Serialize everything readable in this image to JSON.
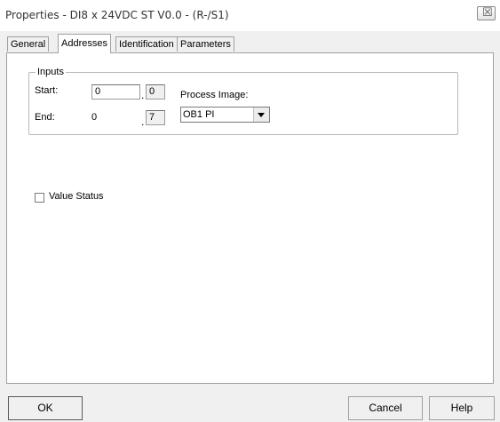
{
  "window": {
    "title": "Properties - DI8 x 24VDC ST V0.0 - (R-/S1)",
    "close_glyph": "☒"
  },
  "tabs": [
    {
      "label": "General",
      "active": false
    },
    {
      "label": "Addresses",
      "active": true
    },
    {
      "label": "Identification",
      "active": false
    },
    {
      "label": "Parameters",
      "active": false
    }
  ],
  "inputs": {
    "group_title": "Inputs",
    "start_label": "Start:",
    "start_byte": "0",
    "start_bit": "0",
    "end_label": "End:",
    "end_byte": "0",
    "end_bit": "7",
    "separator": ".",
    "process_image_label": "Process Image:",
    "process_image_value": "OB1 PI"
  },
  "value_status": {
    "label": "Value Status",
    "checked": false
  },
  "buttons": {
    "ok": "OK",
    "cancel": "Cancel",
    "help": "Help"
  },
  "colors": {
    "dialog_bg": "#f0f0f0",
    "panel_bg": "#ffffff",
    "border": "#a0a0a0"
  },
  "icons": [
    "close-icon",
    "dropdown-arrow-icon"
  ]
}
